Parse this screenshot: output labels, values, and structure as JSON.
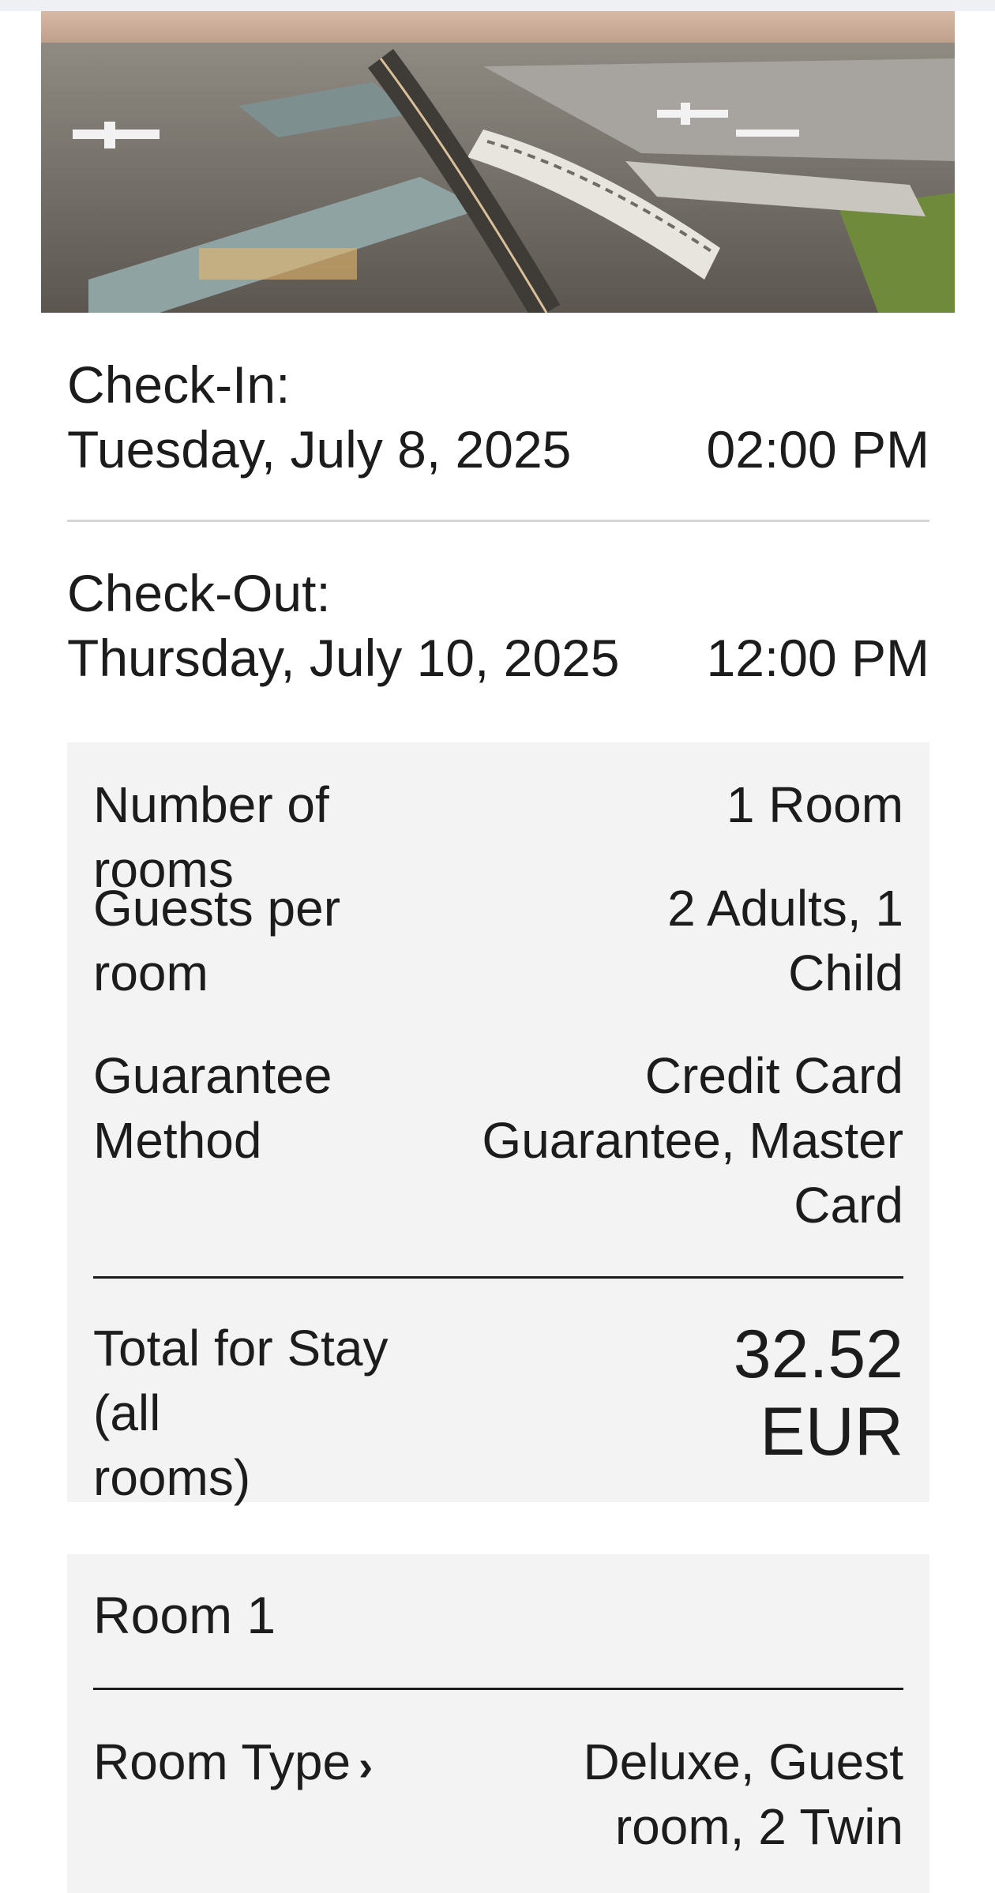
{
  "hero": {
    "image_desc": "aerial-airport-hotel-photo"
  },
  "checkin": {
    "label": "Check-In:",
    "date": "Tuesday, July 8, 2025",
    "time": "02:00 PM"
  },
  "checkout": {
    "label": "Check-Out:",
    "date": "Thursday, July 10, 2025",
    "time": "12:00 PM"
  },
  "summary": {
    "rooms_label": "Number of rooms",
    "rooms_value": "1 Room",
    "guests_label_1": "Guests per",
    "guests_label_2": "room",
    "guests_value_1": "2 Adults, 1",
    "guests_value_2": "Child",
    "guarantee_label_1": "Guarantee",
    "guarantee_label_2": "Method",
    "guarantee_value_1": "Credit Card",
    "guarantee_value_2": "Guarantee, Master",
    "guarantee_value_3": "Card",
    "total_label_1": "Total for Stay (all",
    "total_label_2": "rooms)",
    "total_value_1": "32.52",
    "total_value_2": "EUR"
  },
  "room": {
    "title": "Room 1",
    "type_label": "Room Type",
    "type_chevron": "›",
    "type_value_1": "Deluxe, Guest",
    "type_value_2": "room, 2 Twin"
  },
  "colors": {
    "panel_bg": "#f3f3f3",
    "text": "#1c1c1c",
    "divider": "#d4d4d4"
  }
}
